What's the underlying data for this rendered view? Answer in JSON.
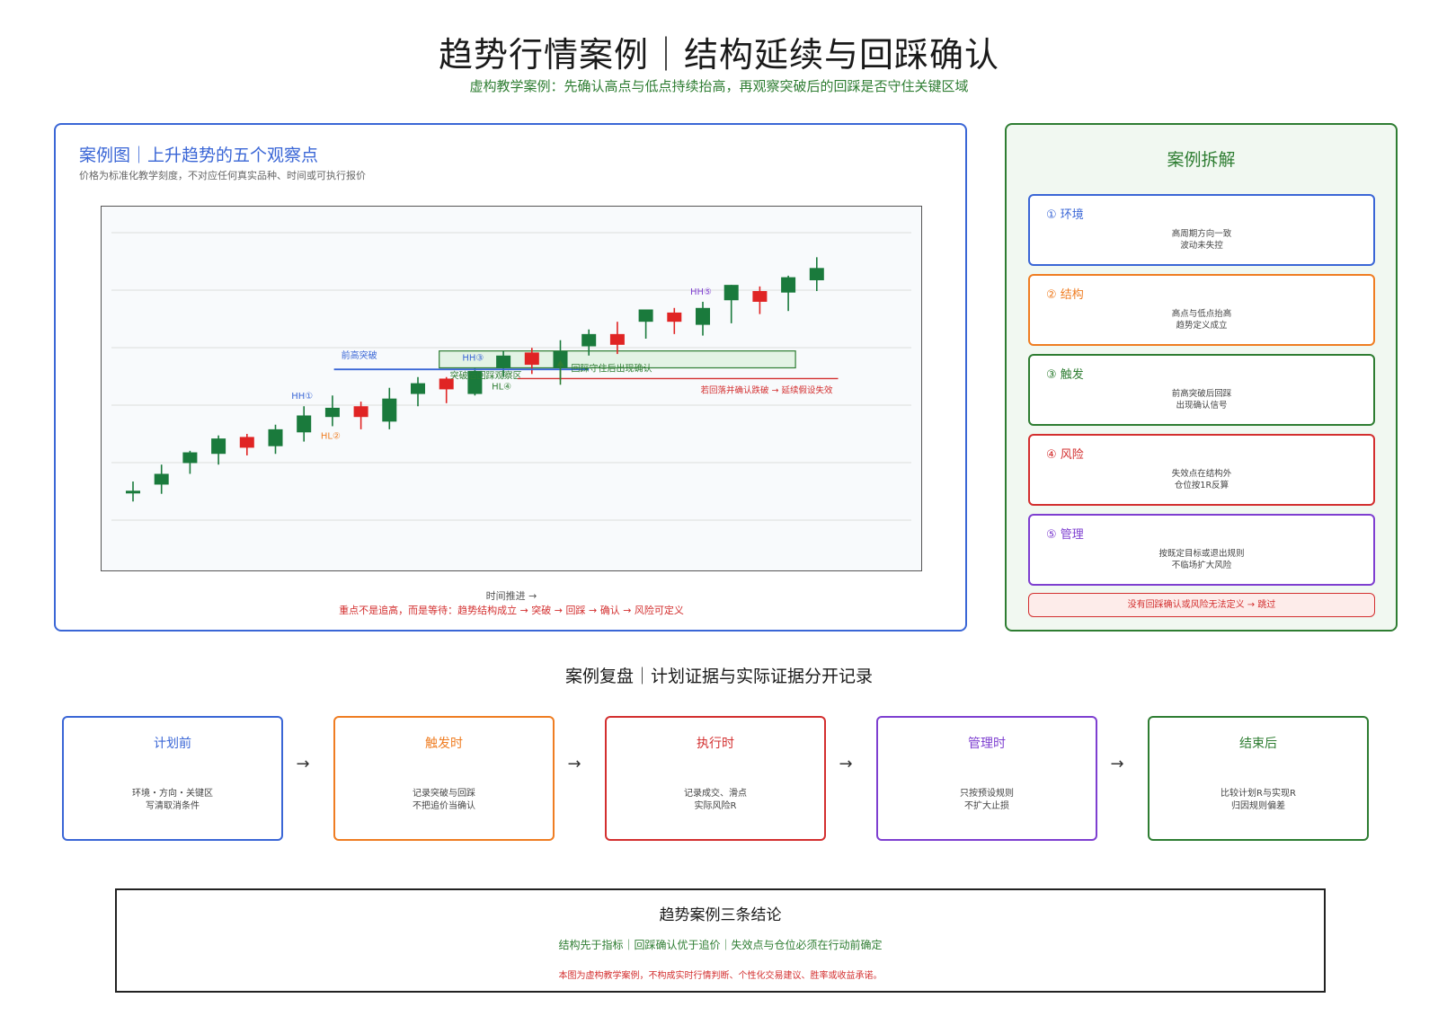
{
  "header": {
    "title": "趋势行情案例｜结构延续与回踩确认",
    "subtitle": "虚构教学案例：先确认高点与低点持续抬高，再观察突破后的回踩是否守住关键区域"
  },
  "chart_panel": {
    "title": "案例图｜上升趋势的五个观察点",
    "note": "价格为标准化教学刻度，不对应任何真实品种、时间或可执行报价",
    "x_axis_label": "时间推进 →",
    "footnote": "重点不是追高，而是等待：趋势结构成立 → 突破 → 回踩 → 确认 → 风险可定义"
  },
  "chart_data": {
    "type": "candlestick",
    "title": "案例图｜上升趋势的五个观察点",
    "xlabel": "时间推进 →",
    "ylabel": "",
    "note": "y values in arbitrary normalized units read from the picture (no price scale printed)",
    "ylim": [
      0,
      100
    ],
    "grid": true,
    "candles": [
      {
        "i": 0,
        "o": 15.5,
        "h": 19,
        "l": 12.5,
        "c": 16.0,
        "dir": "up"
      },
      {
        "i": 1,
        "o": 18,
        "h": 24.5,
        "l": 15,
        "c": 21.5,
        "dir": "up"
      },
      {
        "i": 2,
        "o": 25,
        "h": 29,
        "l": 21.5,
        "c": 28.5,
        "dir": "up"
      },
      {
        "i": 3,
        "o": 28,
        "h": 34,
        "l": 24.5,
        "c": 33,
        "dir": "up"
      },
      {
        "i": 4,
        "o": 30,
        "h": 34.5,
        "l": 27.5,
        "c": 33.5,
        "dir": "down"
      },
      {
        "i": 5,
        "o": 30.5,
        "h": 37.5,
        "l": 28,
        "c": 36,
        "dir": "up"
      },
      {
        "i": 6,
        "o": 35,
        "h": 43.5,
        "l": 32,
        "c": 40.5,
        "dir": "up"
      },
      {
        "i": 7,
        "o": 40,
        "h": 47,
        "l": 37,
        "c": 43,
        "dir": "up"
      },
      {
        "i": 8,
        "o": 40,
        "h": 45,
        "l": 36,
        "c": 43.5,
        "dir": "down"
      },
      {
        "i": 9,
        "o": 38.5,
        "h": 49.5,
        "l": 36,
        "c": 46,
        "dir": "up"
      },
      {
        "i": 10,
        "o": 47.5,
        "h": 53,
        "l": 43.5,
        "c": 51,
        "dir": "up"
      },
      {
        "i": 11,
        "o": 49,
        "h": 53,
        "l": 44.5,
        "c": 52.5,
        "dir": "down"
      },
      {
        "i": 12,
        "o": 47.5,
        "h": 56,
        "l": 47,
        "c": 55,
        "dir": "up"
      },
      {
        "i": 13,
        "o": 56,
        "h": 61.5,
        "l": 53,
        "c": 60,
        "dir": "up"
      },
      {
        "i": 14,
        "o": 57,
        "h": 62.5,
        "l": 54,
        "c": 61,
        "dir": "down"
      },
      {
        "i": 15,
        "o": 56,
        "h": 65,
        "l": 52,
        "c": 61.5,
        "dir": "up"
      },
      {
        "i": 16,
        "o": 63,
        "h": 68.5,
        "l": 60,
        "c": 67,
        "dir": "up"
      },
      {
        "i": 17,
        "o": 63.5,
        "h": 71,
        "l": 60.5,
        "c": 67,
        "dir": "down"
      },
      {
        "i": 18,
        "o": 71,
        "h": 74.5,
        "l": 65.5,
        "c": 75,
        "dir": "up"
      },
      {
        "i": 19,
        "o": 71,
        "h": 75.5,
        "l": 67,
        "c": 74,
        "dir": "down"
      },
      {
        "i": 20,
        "o": 70,
        "h": 77.5,
        "l": 66.5,
        "c": 75.5,
        "dir": "up"
      },
      {
        "i": 21,
        "o": 78,
        "h": 80,
        "l": 70.5,
        "c": 83,
        "dir": "up"
      },
      {
        "i": 22,
        "o": 77.5,
        "h": 82.5,
        "l": 73.5,
        "c": 81,
        "dir": "down"
      },
      {
        "i": 23,
        "o": 80.5,
        "h": 86,
        "l": 74.5,
        "c": 85.5,
        "dir": "up"
      },
      {
        "i": 24,
        "o": 84.5,
        "h": 92,
        "l": 81,
        "c": 88.5,
        "dir": "up"
      }
    ],
    "markers": [
      {
        "label": "HH①",
        "candle": 6,
        "pos": "above",
        "color": "#3a66d6"
      },
      {
        "label": "HL②",
        "candle": 7,
        "pos": "below",
        "color": "#ef7d22"
      },
      {
        "label": "HH③",
        "candle": 12,
        "pos": "above",
        "color": "#3a66d6"
      },
      {
        "label": "HL④",
        "candle": 13,
        "pos": "below",
        "color": "#2e7d32"
      },
      {
        "label": "HH⑤",
        "candle": 20,
        "pos": "above",
        "color": "#7e3fd0"
      }
    ],
    "levels": {
      "breakout_line": {
        "label": "前高突破",
        "y": 55.5,
        "from": 8,
        "to": 16,
        "color": "#3a66d6"
      },
      "retest_zone": {
        "label": "突破后回踩观察区",
        "y_low": 56,
        "y_high": 61.5,
        "from": 11,
        "to": 23,
        "color": "#2e7d32"
      },
      "confirm_note": {
        "label": "回踩守住后出现确认",
        "color": "#2e7d32"
      },
      "invalid_line": {
        "label": "若回落并确认跌破 → 延续假设失效",
        "y": 52.5,
        "from": 14,
        "to": 25,
        "color": "#d32f2f"
      }
    },
    "colors": {
      "up": "#1a7a3c",
      "down": "#e02424",
      "grid": "#dddddd"
    }
  },
  "breakdown": {
    "title": "案例拆解",
    "steps": [
      {
        "title": "① 环境",
        "desc": "高周期方向一致\n波动未失控",
        "color": "#3a66d6"
      },
      {
        "title": "② 结构",
        "desc": "高点与低点抬高\n趋势定义成立",
        "color": "#ef7d22"
      },
      {
        "title": "③ 触发",
        "desc": "前高突破后回踩\n出现确认信号",
        "color": "#2e7d32"
      },
      {
        "title": "④ 风险",
        "desc": "失效点在结构外\n仓位按1R反算",
        "color": "#d32f2f"
      },
      {
        "title": "⑤ 管理",
        "desc": "按既定目标或退出规则\n不临场扩大风险",
        "color": "#7e3fd0"
      }
    ],
    "skip_rule": "没有回踩确认或风险无法定义 → 跳过"
  },
  "review": {
    "title": "案例复盘｜计划证据与实际证据分开记录",
    "arrow": "→",
    "stages": [
      {
        "title": "计划前",
        "desc": "环境・方向・关键区\n写清取消条件",
        "color": "#3a66d6"
      },
      {
        "title": "触发时",
        "desc": "记录突破与回踩\n不把追价当确认",
        "color": "#ef7d22"
      },
      {
        "title": "执行时",
        "desc": "记录成交、滑点\n实际风险R",
        "color": "#d32f2f"
      },
      {
        "title": "管理时",
        "desc": "只按预设规则\n不扩大止损",
        "color": "#7e3fd0"
      },
      {
        "title": "结束后",
        "desc": "比较计划R与实现R\n归因规则偏差",
        "color": "#2e7d32"
      }
    ]
  },
  "conclusion": {
    "title": "趋势案例三条结论",
    "points": "结构先于指标｜回踩确认优于追价｜失效点与仓位必须在行动前确定",
    "disclaimer": "本图为虚构教学案例，不构成实时行情判断、个性化交易建议、胜率或收益承诺。"
  }
}
